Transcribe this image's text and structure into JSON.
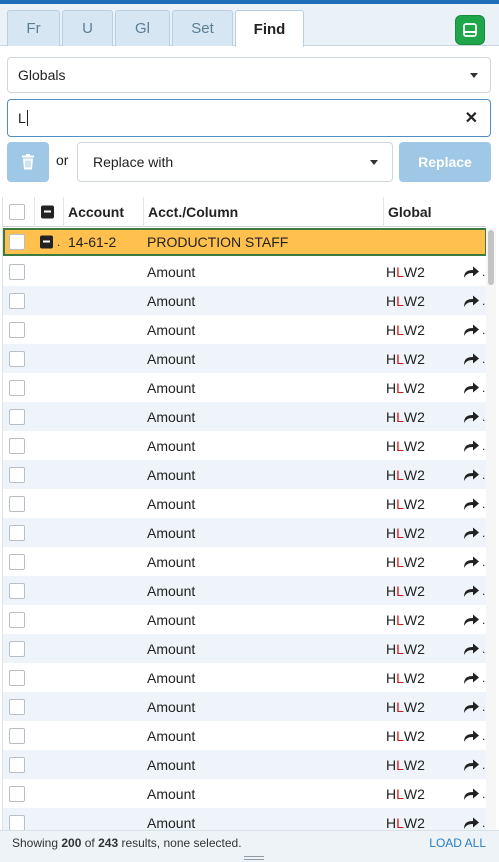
{
  "tabs": [
    {
      "label": "Fr",
      "active": false
    },
    {
      "label": "U",
      "active": false
    },
    {
      "label": "Gl",
      "active": false
    },
    {
      "label": "Set",
      "active": false
    },
    {
      "label": "Find",
      "active": true
    }
  ],
  "scope_select": {
    "value": "Globals"
  },
  "search": {
    "value": "L"
  },
  "or_label": "or",
  "replace_select": {
    "value": "Replace with"
  },
  "replace_button": "Replace",
  "columns": {
    "account": "Account",
    "acct_column": "Acct./Column",
    "global": "Global"
  },
  "group_row": {
    "account": "14-61-2",
    "description": "PRODUCTION STAFF"
  },
  "result_rows": [
    {
      "column": "Amount",
      "global": {
        "pre": "H",
        "match": "L",
        "post": "W2"
      }
    },
    {
      "column": "Amount",
      "global": {
        "pre": "H",
        "match": "L",
        "post": "W2"
      }
    },
    {
      "column": "Amount",
      "global": {
        "pre": "H",
        "match": "L",
        "post": "W2"
      }
    },
    {
      "column": "Amount",
      "global": {
        "pre": "H",
        "match": "L",
        "post": "W2"
      }
    },
    {
      "column": "Amount",
      "global": {
        "pre": "H",
        "match": "L",
        "post": "W2"
      }
    },
    {
      "column": "Amount",
      "global": {
        "pre": "H",
        "match": "L",
        "post": "W2"
      }
    },
    {
      "column": "Amount",
      "global": {
        "pre": "H",
        "match": "L",
        "post": "W2"
      }
    },
    {
      "column": "Amount",
      "global": {
        "pre": "H",
        "match": "L",
        "post": "W2"
      }
    },
    {
      "column": "Amount",
      "global": {
        "pre": "H",
        "match": "L",
        "post": "W2"
      }
    },
    {
      "column": "Amount",
      "global": {
        "pre": "H",
        "match": "L",
        "post": "W2"
      }
    },
    {
      "column": "Amount",
      "global": {
        "pre": "H",
        "match": "L",
        "post": "W2"
      }
    },
    {
      "column": "Amount",
      "global": {
        "pre": "H",
        "match": "L",
        "post": "W2"
      }
    },
    {
      "column": "Amount",
      "global": {
        "pre": "H",
        "match": "L",
        "post": "W2"
      }
    },
    {
      "column": "Amount",
      "global": {
        "pre": "H",
        "match": "L",
        "post": "W2"
      }
    },
    {
      "column": "Amount",
      "global": {
        "pre": "H",
        "match": "L",
        "post": "W2"
      }
    },
    {
      "column": "Amount",
      "global": {
        "pre": "H",
        "match": "L",
        "post": "W2"
      }
    },
    {
      "column": "Amount",
      "global": {
        "pre": "H",
        "match": "L",
        "post": "W2"
      }
    },
    {
      "column": "Amount",
      "global": {
        "pre": "H",
        "match": "L",
        "post": "W2"
      }
    },
    {
      "column": "Amount",
      "global": {
        "pre": "H",
        "match": "L",
        "post": "W2"
      }
    },
    {
      "column": "Amount",
      "global": {
        "pre": "H",
        "match": "L",
        "post": "W2"
      }
    }
  ],
  "footer": {
    "prefix": "Showing ",
    "shown": "200",
    "of": " of ",
    "total": "243",
    "suffix": " results, none selected.",
    "load_all": "LOAD ALL"
  },
  "icons": {
    "corner": "panel-toggle-icon",
    "trash": "trash-icon",
    "clear": "clear-icon",
    "row_action": "redo-arrow-icon"
  },
  "colors": {
    "accent": "#1f6fb8",
    "highlight_row": "#ffc04d",
    "match_text": "#d0191a",
    "button_disabled": "#9fc8e6",
    "corner_button": "#1fa64a"
  }
}
